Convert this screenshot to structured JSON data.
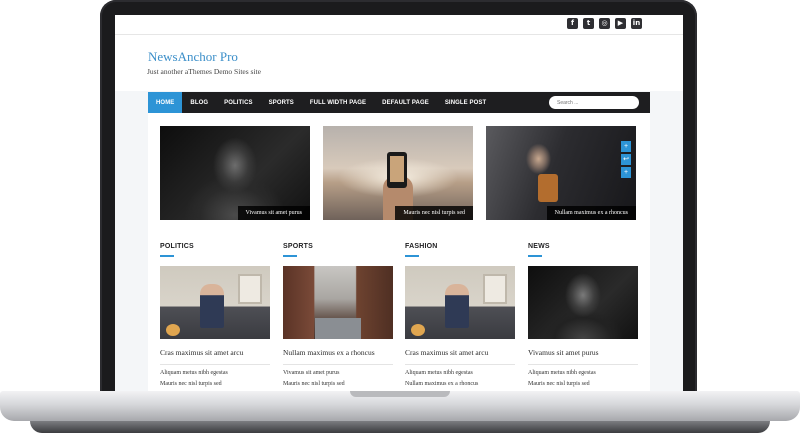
{
  "site": {
    "title": "NewsAnchor Pro",
    "tagline": "Just another aThemes Demo Sites site"
  },
  "social_icons": [
    {
      "icon": "facebook-icon",
      "glyph": "f"
    },
    {
      "icon": "twitter-icon",
      "glyph": "t"
    },
    {
      "icon": "instagram-icon",
      "glyph": "◎"
    },
    {
      "icon": "youtube-icon",
      "glyph": "▶"
    },
    {
      "icon": "linkedin-icon",
      "glyph": "in"
    }
  ],
  "nav": {
    "items": [
      "HOME",
      "BLOG",
      "POLITICS",
      "SPORTS",
      "FULL WIDTH PAGE",
      "DEFAULT PAGE",
      "SINGLE POST"
    ],
    "active": "HOME",
    "search_placeholder": "Search ..."
  },
  "featured": [
    {
      "caption": "Vivamus sit amet purus"
    },
    {
      "caption": "Mauris nec nisl turpis sed"
    },
    {
      "caption": "Nullam maximus ex a rhoncus"
    }
  ],
  "share_icons": [
    "+",
    "↩",
    "+"
  ],
  "columns": [
    {
      "title": "POLITICS",
      "headline": "Cras maximus sit amet arcu",
      "links": [
        "Aliquam metus nibh egestas",
        "Mauris nec nisl turpis sed"
      ]
    },
    {
      "title": "SPORTS",
      "headline": "Nullam maximus ex a rhoncus",
      "links": [
        "Vivamus sit amet purus",
        "Mauris nec nisl turpis sed"
      ]
    },
    {
      "title": "FASHION",
      "headline": "Cras maximus sit amet arcu",
      "links": [
        "Aliquam metus nibh egestas",
        "Nullam maximus ex a rhoncus"
      ]
    },
    {
      "title": "NEWS",
      "headline": "Vivamus sit amet purus",
      "links": [
        "Aliquam metus nibh egestas",
        "Mauris nec nisl turpis sed"
      ]
    }
  ],
  "colors": {
    "accent": "#2d94d6",
    "nav_bg": "#1e1e20",
    "title": "#3c8fc9"
  }
}
